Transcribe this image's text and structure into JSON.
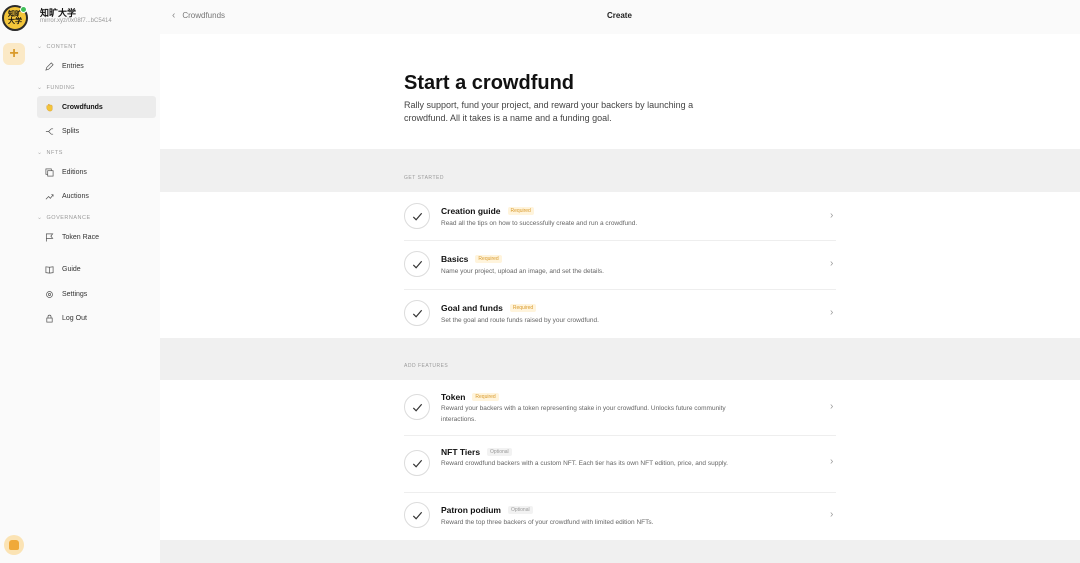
{
  "publication": {
    "name": "知旷大学",
    "address": "mirror.xyz/0x08f7...bC5414",
    "logo_text_line1": "知旷",
    "logo_text_line2": "大学"
  },
  "rail": {
    "new_label": "+"
  },
  "sidebar": {
    "sections": [
      {
        "label": "CONTENT",
        "items": [
          {
            "label": "Entries",
            "icon": "pencil-icon",
            "active": false
          }
        ]
      },
      {
        "label": "FUNDING",
        "items": [
          {
            "label": "Crowdfunds",
            "icon": "hand-icon",
            "active": true
          },
          {
            "label": "Splits",
            "icon": "split-icon",
            "active": false
          }
        ]
      },
      {
        "label": "NFTS",
        "items": [
          {
            "label": "Editions",
            "icon": "copy-icon",
            "active": false
          },
          {
            "label": "Auctions",
            "icon": "trend-icon",
            "active": false
          }
        ]
      },
      {
        "label": "GOVERNANCE",
        "items": [
          {
            "label": "Token Race",
            "icon": "flag-icon",
            "active": false
          }
        ]
      }
    ],
    "footer_items": [
      {
        "label": "Guide",
        "icon": "book-icon"
      },
      {
        "label": "Settings",
        "icon": "gear-icon"
      },
      {
        "label": "Log Out",
        "icon": "lock-icon"
      }
    ]
  },
  "topbar": {
    "back_label": "Crowdfunds",
    "title": "Create"
  },
  "hero": {
    "title": "Start a crowdfund",
    "description": "Rally support, fund your project, and reward your backers by launching a crowdfund. All it takes is a name and a funding goal."
  },
  "get_started": {
    "label": "GET STARTED",
    "rows": [
      {
        "title": "Creation guide",
        "badge": "Required",
        "desc": "Read all the tips on how to successfully create and run a crowdfund."
      },
      {
        "title": "Basics",
        "badge": "Required",
        "desc": "Name your project, upload an image, and set the details."
      },
      {
        "title": "Goal and funds",
        "badge": "Required",
        "desc": "Set the goal and route funds raised by your crowdfund."
      }
    ]
  },
  "add_features": {
    "label": "ADD FEATURES",
    "rows": [
      {
        "title": "Token",
        "badge": "Required",
        "desc": "Reward your backers with a token representing stake in your crowdfund. Unlocks future community interactions."
      },
      {
        "title": "NFT Tiers",
        "badge": "Optional",
        "desc": "Reward crowdfund backers with a custom NFT. Each tier has its own NFT edition, price, and supply."
      },
      {
        "title": "Patron podium",
        "badge": "Optional",
        "desc": "Reward the top three backers of your crowdfund with limited edition NFTs."
      }
    ]
  },
  "colors": {
    "accent": "#d99a2b",
    "badge_bg": "#fff4dc",
    "logo_yellow": "#f3c53a",
    "online_green": "#3fbf5a"
  }
}
